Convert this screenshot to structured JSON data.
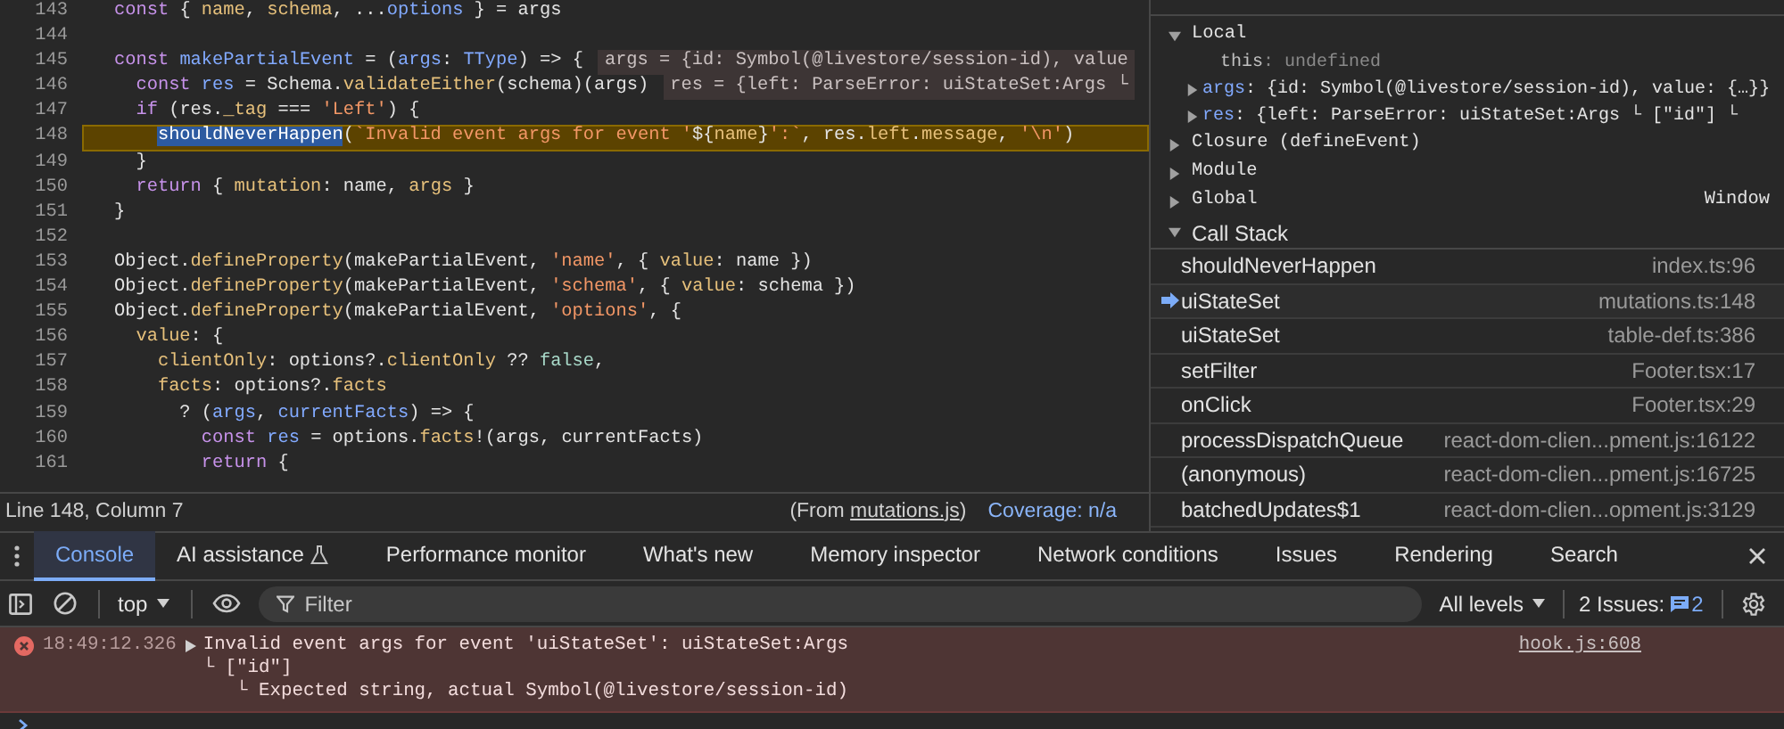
{
  "editor": {
    "lines": [
      {
        "number": "143",
        "highlighted": false,
        "tokens": [
          {
            "kind": "keyword",
            "text": "const"
          },
          {
            "kind": "plain",
            "text": " { "
          },
          {
            "kind": "property",
            "text": "name"
          },
          {
            "kind": "plain",
            "text": ", "
          },
          {
            "kind": "property",
            "text": "schema"
          },
          {
            "kind": "plain",
            "text": ", ..."
          },
          {
            "kind": "variable",
            "text": "options"
          },
          {
            "kind": "plain",
            "text": " } = args"
          }
        ]
      },
      {
        "number": "144",
        "highlighted": false
      },
      {
        "number": "145",
        "highlighted": false,
        "tokens": [
          {
            "kind": "keyword",
            "text": "const"
          },
          {
            "kind": "variable",
            "text": " makePartialEvent"
          },
          {
            "kind": "plain",
            "text": " = ("
          },
          {
            "kind": "variable",
            "text": "args"
          },
          {
            "kind": "plain",
            "text": ": "
          },
          {
            "kind": "variable",
            "text": "TType"
          },
          {
            "kind": "plain",
            "text": ") => {"
          }
        ],
        "inline_value": "args = {id: Symbol(@livestore/session-id), value"
      },
      {
        "number": "146",
        "highlighted": false,
        "tokens": [
          {
            "kind": "keyword",
            "text": "  const"
          },
          {
            "kind": "variable",
            "text": " res"
          },
          {
            "kind": "plain",
            "text": " = Schema."
          },
          {
            "kind": "property",
            "text": "validateEither"
          },
          {
            "kind": "plain",
            "text": "(schema)(args)"
          }
        ],
        "inline_value": "res = {left: ParseError: uiStateSet:Args └"
      },
      {
        "number": "147",
        "highlighted": false,
        "tokens": [
          {
            "kind": "keyword",
            "text": "  if"
          },
          {
            "kind": "plain",
            "text": " (res."
          },
          {
            "kind": "property",
            "text": "_tag"
          },
          {
            "kind": "plain",
            "text": " === "
          },
          {
            "kind": "string",
            "text": "'Left'"
          },
          {
            "kind": "plain",
            "text": ") {"
          }
        ]
      },
      {
        "number": "148",
        "highlighted": true,
        "tokens": [
          {
            "kind": "selection",
            "text": "shouldNeverHappen"
          },
          {
            "kind": "plain",
            "text": "("
          },
          {
            "kind": "string",
            "text": "`Invalid event args for event '"
          },
          {
            "kind": "plain",
            "text": "${"
          },
          {
            "kind": "property",
            "text": "name"
          },
          {
            "kind": "plain",
            "text": "}"
          },
          {
            "kind": "string",
            "text": "':`"
          },
          {
            "kind": "plain",
            "text": ", res."
          },
          {
            "kind": "property",
            "text": "left"
          },
          {
            "kind": "plain",
            "text": "."
          },
          {
            "kind": "property",
            "text": "message"
          },
          {
            "kind": "plain",
            "text": ", "
          },
          {
            "kind": "string",
            "text": "'\\n'"
          },
          {
            "kind": "plain",
            "text": ")"
          }
        ]
      },
      {
        "number": "149",
        "highlighted": false,
        "tokens": [
          {
            "kind": "plain",
            "text": "  }"
          }
        ]
      },
      {
        "number": "150",
        "highlighted": false,
        "tokens": [
          {
            "kind": "keyword",
            "text": "  return"
          },
          {
            "kind": "plain",
            "text": " { "
          },
          {
            "kind": "property",
            "text": "mutation"
          },
          {
            "kind": "plain",
            "text": ": name, "
          },
          {
            "kind": "property",
            "text": "args"
          },
          {
            "kind": "plain",
            "text": " }"
          }
        ]
      },
      {
        "number": "151",
        "highlighted": false,
        "tokens": [
          {
            "kind": "plain",
            "text": "}"
          }
        ]
      },
      {
        "number": "152",
        "highlighted": false
      },
      {
        "number": "153",
        "highlighted": false,
        "tokens": [
          {
            "kind": "plain",
            "text": "Object."
          },
          {
            "kind": "property",
            "text": "defineProperty"
          },
          {
            "kind": "plain",
            "text": "(makePartialEvent, "
          },
          {
            "kind": "string",
            "text": "'name'"
          },
          {
            "kind": "plain",
            "text": ", { "
          },
          {
            "kind": "property",
            "text": "value"
          },
          {
            "kind": "plain",
            "text": ": name })"
          }
        ]
      },
      {
        "number": "154",
        "highlighted": false,
        "tokens": [
          {
            "kind": "plain",
            "text": "Object."
          },
          {
            "kind": "property",
            "text": "defineProperty"
          },
          {
            "kind": "plain",
            "text": "(makePartialEvent, "
          },
          {
            "kind": "string",
            "text": "'schema'"
          },
          {
            "kind": "plain",
            "text": ", { "
          },
          {
            "kind": "property",
            "text": "value"
          },
          {
            "kind": "plain",
            "text": ": schema })"
          }
        ]
      },
      {
        "number": "155",
        "highlighted": false,
        "tokens": [
          {
            "kind": "plain",
            "text": "Object."
          },
          {
            "kind": "property",
            "text": "defineProperty"
          },
          {
            "kind": "plain",
            "text": "(makePartialEvent, "
          },
          {
            "kind": "string",
            "text": "'options'"
          },
          {
            "kind": "plain",
            "text": ", {"
          }
        ]
      },
      {
        "number": "156",
        "highlighted": false,
        "tokens": [
          {
            "kind": "property",
            "text": "  value"
          },
          {
            "kind": "plain",
            "text": ": {"
          }
        ]
      },
      {
        "number": "157",
        "highlighted": false,
        "tokens": [
          {
            "kind": "property",
            "text": "    clientOnly"
          },
          {
            "kind": "plain",
            "text": ": options?."
          },
          {
            "kind": "property",
            "text": "clientOnly"
          },
          {
            "kind": "plain",
            "text": " ?? "
          },
          {
            "kind": "literal",
            "text": "false"
          },
          {
            "kind": "plain",
            "text": ","
          }
        ]
      },
      {
        "number": "158",
        "highlighted": false,
        "tokens": [
          {
            "kind": "property",
            "text": "    facts"
          },
          {
            "kind": "plain",
            "text": ": options?."
          },
          {
            "kind": "property",
            "text": "facts"
          }
        ]
      },
      {
        "number": "159",
        "highlighted": false,
        "tokens": [
          {
            "kind": "plain",
            "text": "      ? ("
          },
          {
            "kind": "variable",
            "text": "args"
          },
          {
            "kind": "plain",
            "text": ", "
          },
          {
            "kind": "variable",
            "text": "currentFacts"
          },
          {
            "kind": "plain",
            "text": ") => {"
          }
        ]
      },
      {
        "number": "160",
        "highlighted": false,
        "tokens": [
          {
            "kind": "keyword",
            "text": "        const"
          },
          {
            "kind": "variable",
            "text": " res"
          },
          {
            "kind": "plain",
            "text": " = options."
          },
          {
            "kind": "property",
            "text": "facts"
          },
          {
            "kind": "plain",
            "text": "!(args, currentFacts)"
          }
        ]
      },
      {
        "number": "161",
        "highlighted": false,
        "tokens": [
          {
            "kind": "keyword",
            "text": "        return"
          },
          {
            "kind": "plain",
            "text": " {"
          }
        ]
      }
    ],
    "status_bar": {
      "position": "Line 148, Column 7",
      "source_prefix": "(From ",
      "source_link": "mutations.js",
      "source_suffix": ")",
      "coverage": "Coverage: n/a"
    }
  },
  "scope": {
    "sections": [
      {
        "label": "Local",
        "expanded": true,
        "children": [
          {
            "name": "this",
            "value": ": undefined",
            "expandable": false
          },
          {
            "name": "args",
            "value": ": {id: Symbol(@livestore/session-id), value: {…}}",
            "expandable": true
          },
          {
            "name": "res",
            "value": ": {left: ParseError: uiStateSet:Args └ [\"id\"] └",
            "expandable": true
          }
        ]
      },
      {
        "label": "Closure (defineEvent)",
        "expanded": false
      },
      {
        "label": "Module",
        "expanded": false
      },
      {
        "label": "Global",
        "expanded": false,
        "value": "Window"
      }
    ]
  },
  "call_stack": {
    "label": "Call Stack",
    "expanded": true,
    "frames": [
      {
        "function": "shouldNeverHappen",
        "location": "index.ts:96",
        "selected": false
      },
      {
        "function": "uiStateSet",
        "location": "mutations.ts:148",
        "selected": true
      },
      {
        "function": "uiStateSet",
        "location": "table-def.ts:386",
        "selected": false
      },
      {
        "function": "setFilter",
        "location": "Footer.tsx:17",
        "selected": false
      },
      {
        "function": "onClick",
        "location": "Footer.tsx:29",
        "selected": false
      },
      {
        "function": "processDispatchQueue",
        "location": "react-dom-clien...pment.js:16122",
        "selected": false
      },
      {
        "function": "(anonymous)",
        "location": "react-dom-clien...pment.js:16725",
        "selected": false
      },
      {
        "function": "batchedUpdates$1",
        "location": "react-dom-clien...opment.js:3129",
        "selected": false
      }
    ]
  },
  "drawer": {
    "tabs": [
      {
        "label": "Console",
        "selected": true
      },
      {
        "label": "AI assistance",
        "selected": false,
        "kind": "experimental"
      },
      {
        "label": "Performance monitor",
        "selected": false
      },
      {
        "label": "What's new",
        "selected": false
      },
      {
        "label": "Memory inspector",
        "selected": false
      },
      {
        "label": "Network conditions",
        "selected": false
      },
      {
        "label": "Issues",
        "selected": false
      },
      {
        "label": "Rendering",
        "selected": false
      },
      {
        "label": "Search",
        "selected": false
      }
    ],
    "toolbar": {
      "context": "top",
      "filter_placeholder": "Filter",
      "levels": "All levels",
      "issues_label": "2 Issues:",
      "issues_count": "2"
    },
    "messages": [
      {
        "kind": "error",
        "time": "18:49:12.326",
        "lines": [
          "Invalid event args for event 'uiStateSet': uiStateSet:Args",
          "└ [\"id\"]",
          "   └ Expected string, actual Symbol(@livestore/session-id)"
        ],
        "source": "hook.js:608"
      }
    ]
  }
}
